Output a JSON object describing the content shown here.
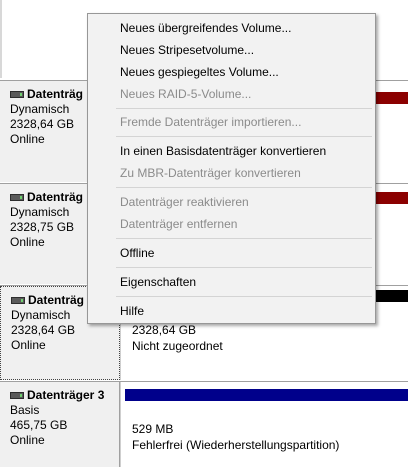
{
  "disks": [
    {
      "name": "Datenträg",
      "type": "Dynamisch",
      "size": "2328,64 GB",
      "status": "Online",
      "bar_color": "#8b0000"
    },
    {
      "name": "Datenträg",
      "type": "Dynamisch",
      "size": "2328,75 GB",
      "status": "Online",
      "bar_color": "#8b0000"
    },
    {
      "name": "Datenträg",
      "type": "Dynamisch",
      "size": "2328,64 GB",
      "status": "Online",
      "bar_color": "#000000",
      "partition": {
        "size": "2328,64 GB",
        "status": "Nicht zugeordnet"
      }
    },
    {
      "name": "Datenträger 3",
      "type": "Basis",
      "size": "465,75 GB",
      "status": "Online",
      "bar_color": "#00008b",
      "partition": {
        "size": "529 MB",
        "status": "Fehlerfrei (Wiederherstellungspartition)"
      }
    }
  ],
  "context_menu": {
    "items": [
      {
        "label": "Neues übergreifendes Volume...",
        "enabled": true
      },
      {
        "label": "Neues Stripesetvolume...",
        "enabled": true
      },
      {
        "label": "Neues gespiegeltes Volume...",
        "enabled": true
      },
      {
        "label": "Neues RAID-5-Volume...",
        "enabled": false
      },
      {
        "label": "Fremde Datenträger importieren...",
        "enabled": false
      },
      {
        "label": "In einen Basisdatenträger konvertieren",
        "enabled": true
      },
      {
        "label": "Zu MBR-Datenträger konvertieren",
        "enabled": false
      },
      {
        "label": "Datenträger reaktivieren",
        "enabled": false
      },
      {
        "label": "Datenträger entfernen",
        "enabled": false
      },
      {
        "label": "Offline",
        "enabled": true
      },
      {
        "label": "Eigenschaften",
        "enabled": true
      },
      {
        "label": "Hilfe",
        "enabled": true
      }
    ]
  }
}
